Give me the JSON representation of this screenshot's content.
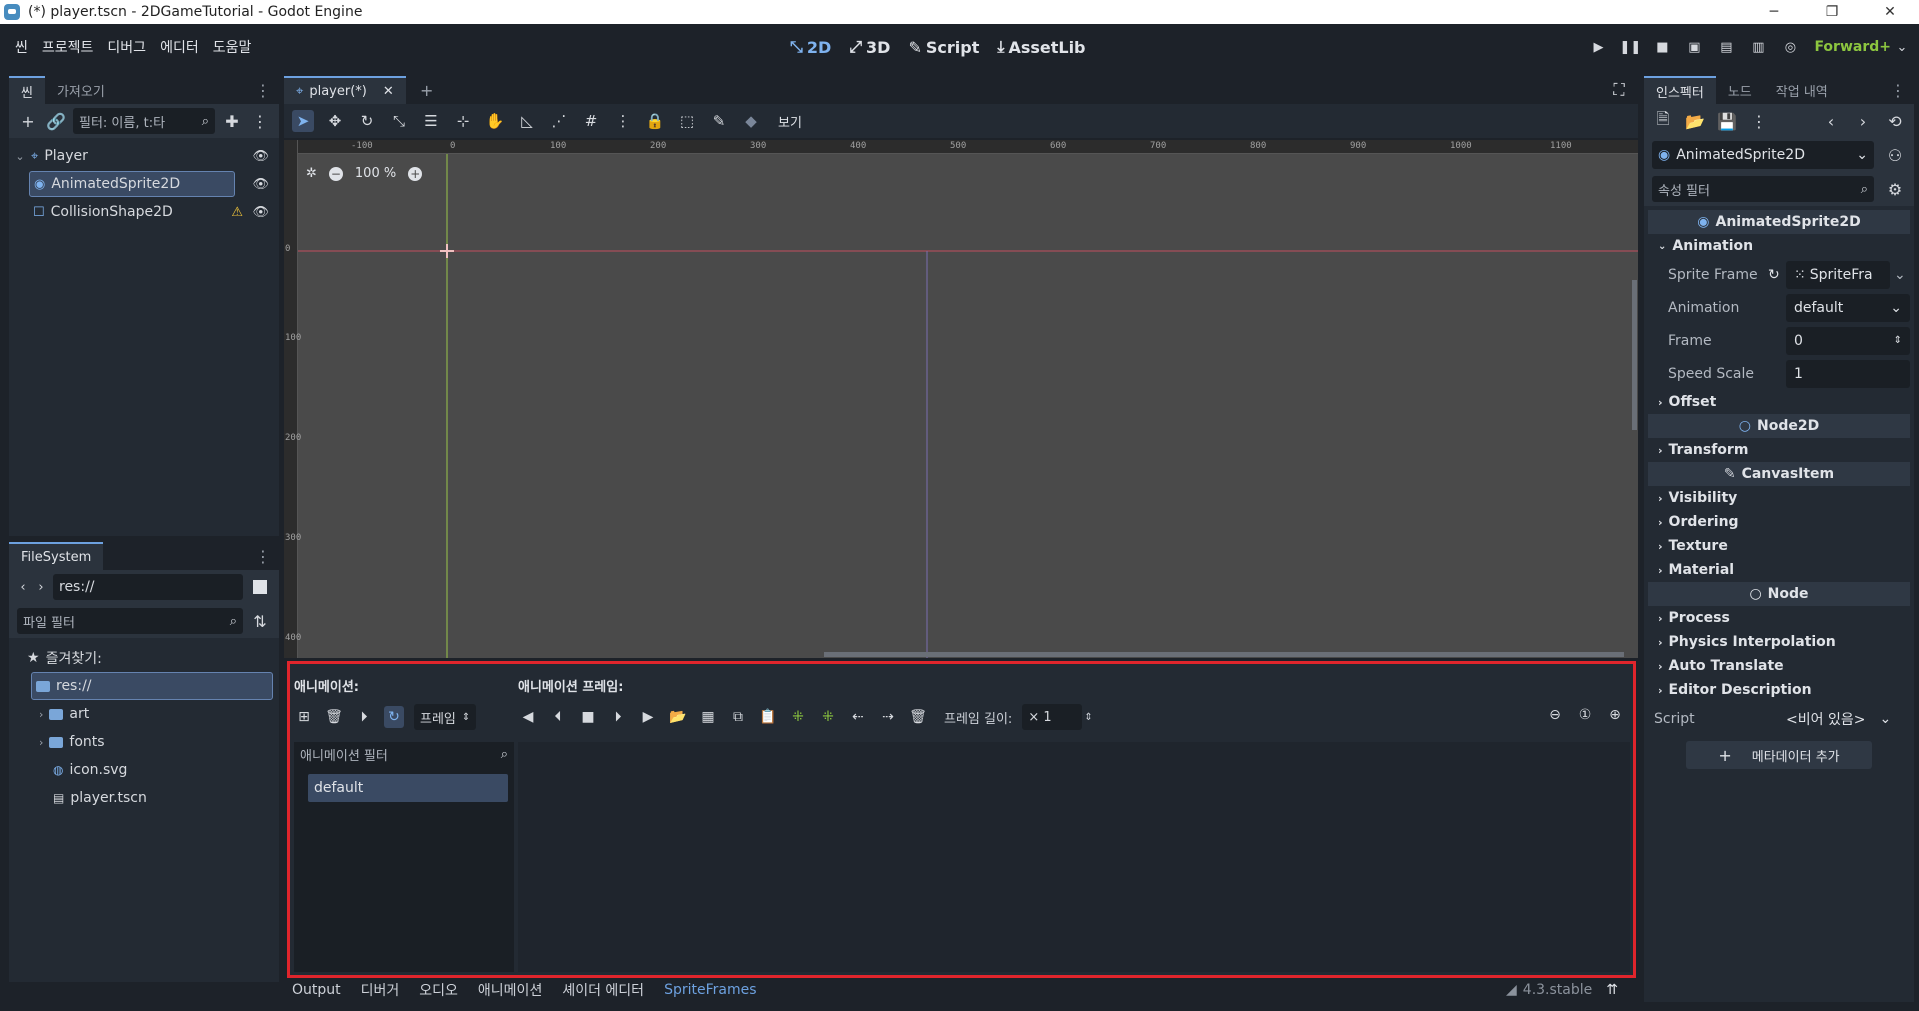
{
  "window": {
    "title": "(*) player.tscn - 2DGameTutorial - Godot Engine",
    "minimize": "─",
    "maximize": "❐",
    "close": "✕"
  },
  "menu": {
    "items": [
      "씬",
      "프로젝트",
      "디버그",
      "에디터",
      "도움말"
    ]
  },
  "workspace": {
    "btn2d": "2D",
    "btn3d": "3D",
    "script": "Script",
    "assetlib": "AssetLib"
  },
  "renderer": "Forward+",
  "scene_dock": {
    "tabs": [
      "씬",
      "가져오기"
    ],
    "filter_placeholder": "필터: 이름, t:타",
    "nodes": [
      {
        "name": "Player"
      },
      {
        "name": "AnimatedSprite2D"
      },
      {
        "name": "CollisionShape2D"
      }
    ]
  },
  "filesystem": {
    "tab": "FileSystem",
    "path": "res://",
    "filter_placeholder": "파일 필터",
    "favorites": "즐겨찾기:",
    "items": [
      "res://",
      "art",
      "fonts",
      "icon.svg",
      "player.tscn"
    ]
  },
  "editor": {
    "tab": "player(*)",
    "view_menu": "보기",
    "zoom": "100 %",
    "ruler_top": [
      "-100",
      "0",
      "100",
      "200",
      "300",
      "400",
      "500",
      "600",
      "700",
      "800",
      "900",
      "1000",
      "1100"
    ],
    "ruler_left": [
      "0",
      "100",
      "200",
      "300",
      "400"
    ]
  },
  "animation_panel": {
    "animations_label": "애니메이션:",
    "frames_label": "애니메이션 프레임:",
    "playback_mode": "프레임",
    "frame_length_label": "프레임 길이:",
    "frame_length_value": "× 1",
    "filter_placeholder": "애니메이션 필터",
    "animations": [
      "default"
    ]
  },
  "bottom_tabs": {
    "items": [
      "Output",
      "디버거",
      "오디오",
      "애니메이션",
      "셰이더 에디터",
      "SpriteFrames"
    ],
    "version": "4.3.stable"
  },
  "inspector": {
    "tabs": [
      "인스펙터",
      "노드",
      "작업 내역"
    ],
    "object": "AnimatedSprite2D",
    "filter_placeholder": "속성 필터",
    "class_header": "AnimatedSprite2D",
    "animation_group": "Animation",
    "props": {
      "sprite_frames": {
        "name": "Sprite Frame",
        "value": "SpriteFra"
      },
      "animation": {
        "name": "Animation",
        "value": "default"
      },
      "frame": {
        "name": "Frame",
        "value": "0"
      },
      "speed_scale": {
        "name": "Speed Scale",
        "value": "1"
      }
    },
    "offset": "Offset",
    "node2d": "Node2D",
    "transform": "Transform",
    "canvasitem": "CanvasItem",
    "visibility": "Visibility",
    "ordering": "Ordering",
    "texture": "Texture",
    "material": "Material",
    "node": "Node",
    "process": "Process",
    "physics_interpolation": "Physics Interpolation",
    "auto_translate": "Auto Translate",
    "editor_description": "Editor Description",
    "script": {
      "name": "Script",
      "value": "<비어 있음>"
    },
    "add_metadata": "메타데이터 추가"
  }
}
